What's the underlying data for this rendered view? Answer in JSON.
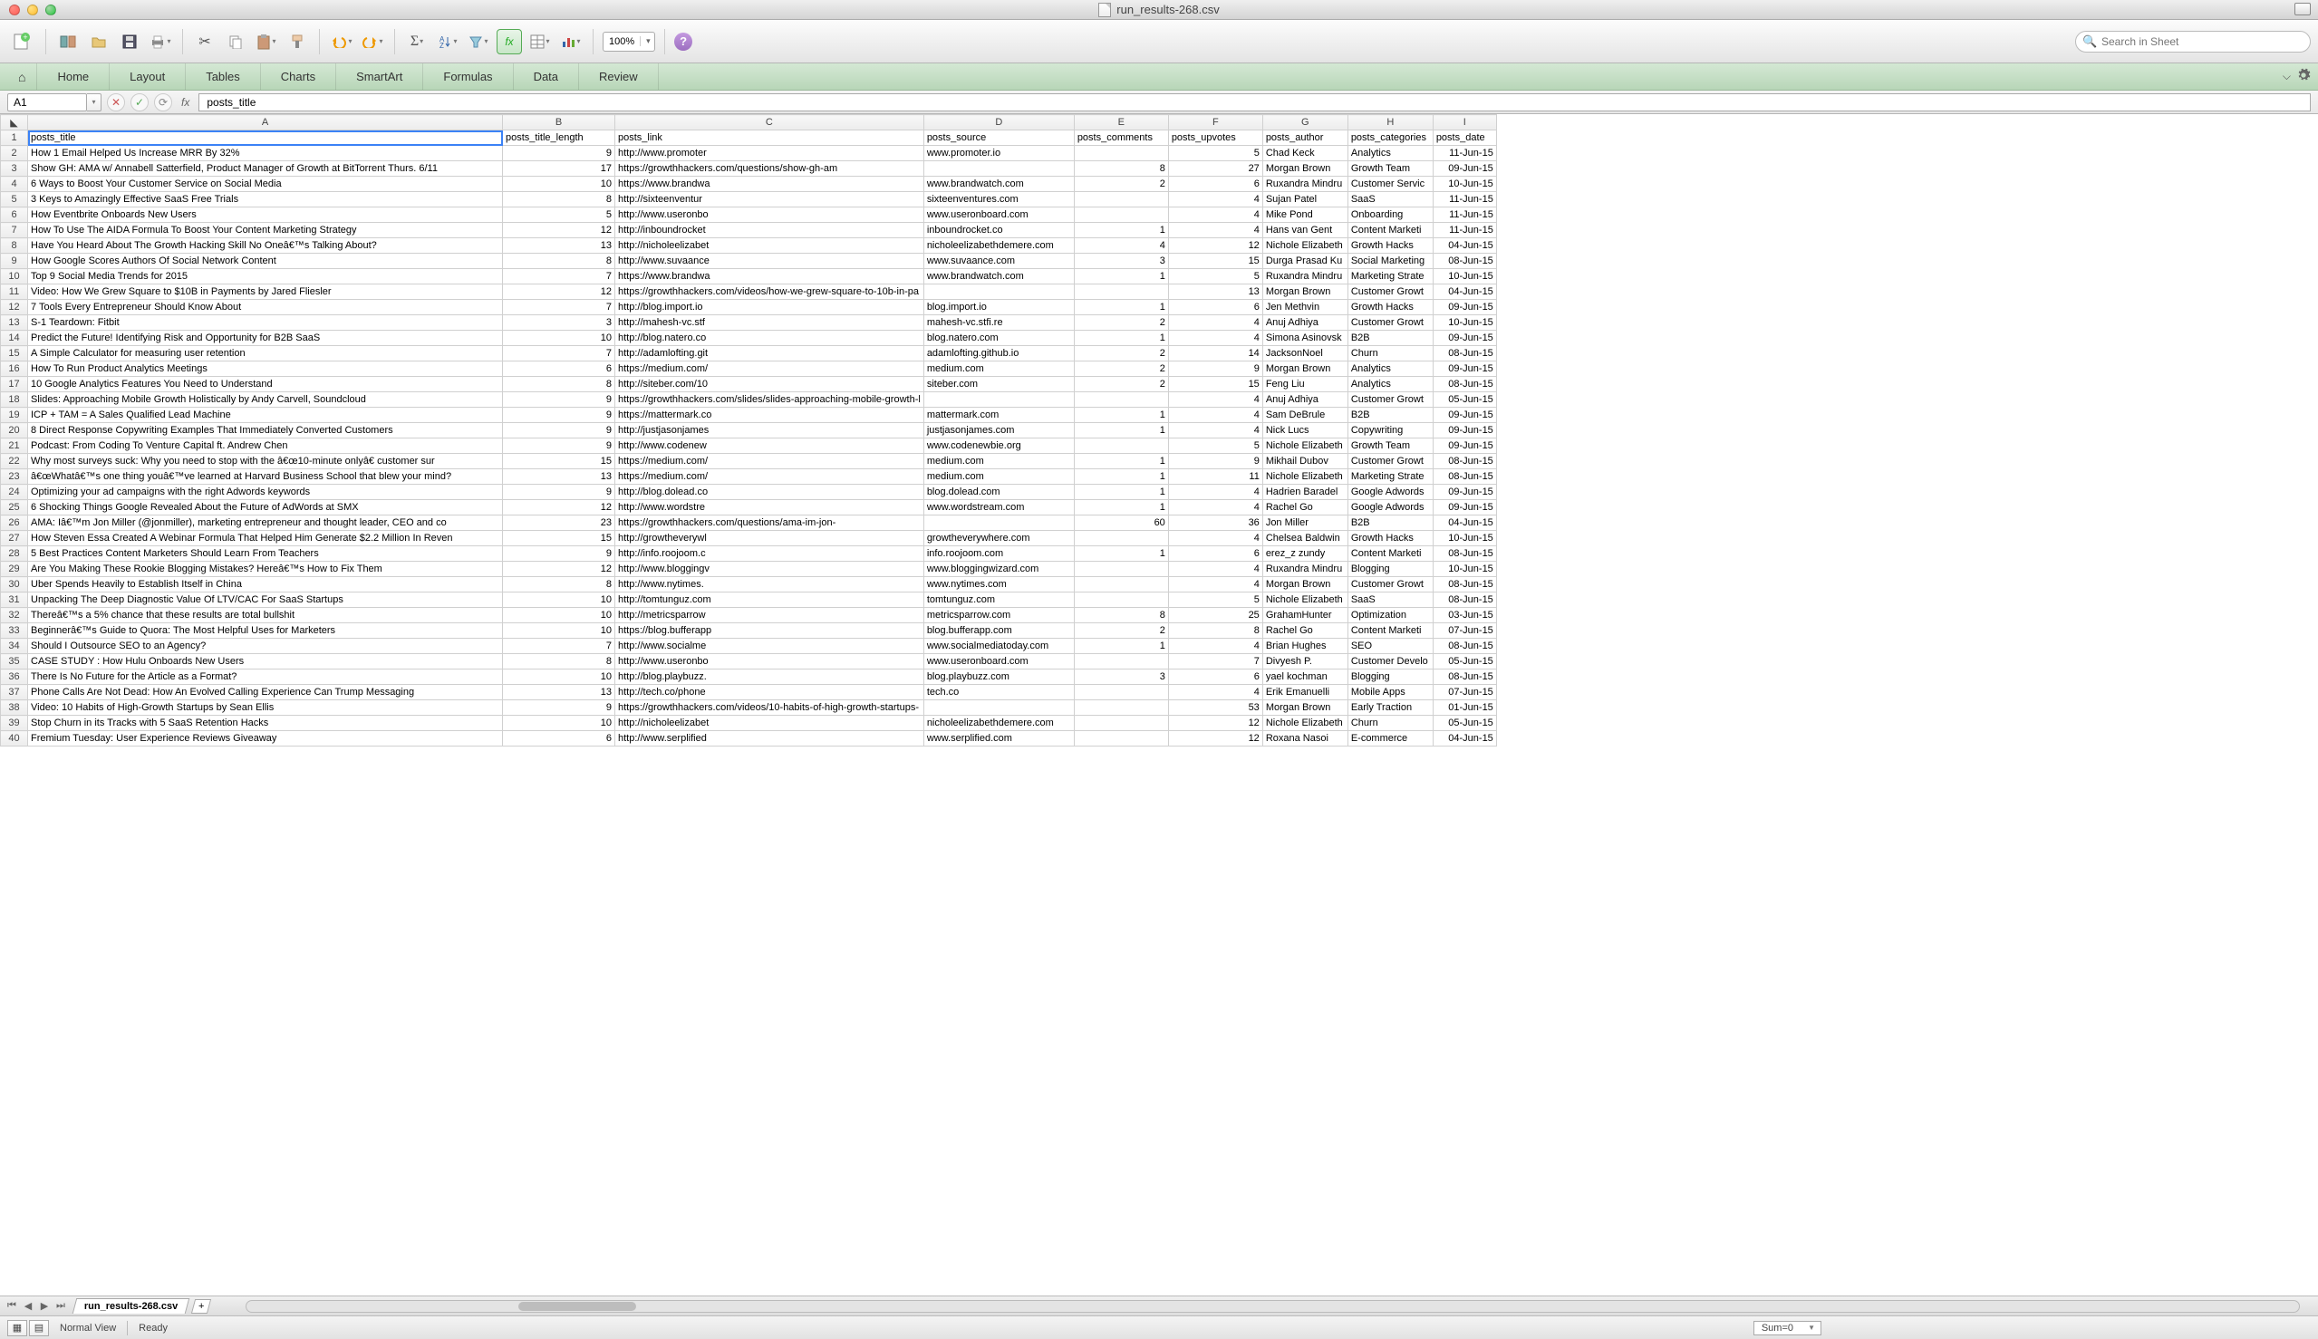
{
  "window": {
    "title": "run_results-268.csv"
  },
  "toolbar": {
    "zoom": "100%",
    "search_placeholder": "Search in Sheet"
  },
  "ribbon": {
    "tabs": [
      "Home",
      "Layout",
      "Tables",
      "Charts",
      "SmartArt",
      "Formulas",
      "Data",
      "Review"
    ]
  },
  "formula_bar": {
    "cell_ref": "A1",
    "fx": "fx",
    "value": "posts_title"
  },
  "sheet": {
    "columns": [
      "A",
      "B",
      "C",
      "D",
      "E",
      "F",
      "G",
      "H",
      "I"
    ],
    "headers": {
      "A": "posts_title",
      "B": "posts_title_length",
      "C": "posts_link",
      "D": "posts_source",
      "E": "posts_comments",
      "F": "posts_upvotes",
      "G": "posts_author",
      "H": "posts_categories",
      "I": "posts_date"
    },
    "rows": [
      {
        "A": "How 1 Email Helped Us Increase MRR By 32%",
        "B": 9,
        "C": "http://www.promoter",
        "D": "www.promoter.io",
        "E": "",
        "F": 5,
        "G": "Chad Keck",
        "H": "Analytics",
        "I": "11-Jun-15"
      },
      {
        "A": "Show GH: AMA w/ Annabell Satterfield, Product Manager of Growth at BitTorrent Thurs. 6/11",
        "B": 17,
        "C": "https://growthhackers.com/questions/show-gh-am",
        "D": "",
        "E": 8,
        "F": 27,
        "G": "Morgan Brown",
        "H": "Growth Team",
        "I": "09-Jun-15"
      },
      {
        "A": "6 Ways to Boost Your Customer Service on Social Media",
        "B": 10,
        "C": "https://www.brandwa",
        "D": "www.brandwatch.com",
        "E": 2,
        "F": 6,
        "G": "Ruxandra Mindru",
        "H": "Customer Servic",
        "I": "10-Jun-15"
      },
      {
        "A": "3 Keys to Amazingly Effective SaaS Free Trials",
        "B": 8,
        "C": "http://sixteenventur",
        "D": "sixteenventures.com",
        "E": "",
        "F": 4,
        "G": "Sujan Patel",
        "H": "SaaS",
        "I": "11-Jun-15"
      },
      {
        "A": "How Eventbrite Onboards New Users",
        "B": 5,
        "C": "http://www.useronbo",
        "D": "www.useronboard.com",
        "E": "",
        "F": 4,
        "G": "Mike Pond",
        "H": "Onboarding",
        "I": "11-Jun-15"
      },
      {
        "A": "How To Use The AIDA Formula To Boost Your Content Marketing Strategy",
        "B": 12,
        "C": "http://inboundrocket",
        "D": "inboundrocket.co",
        "E": 1,
        "F": 4,
        "G": "Hans van Gent",
        "H": "Content Marketi",
        "I": "11-Jun-15"
      },
      {
        "A": "Have You Heard About The Growth Hacking Skill No Oneâ€™s Talking About?",
        "B": 13,
        "C": "http://nicholeelizabet",
        "D": "nicholeelizabethdemere.com",
        "E": 4,
        "F": 12,
        "G": "Nichole Elizabeth",
        "H": "Growth Hacks",
        "I": "04-Jun-15"
      },
      {
        "A": "How Google Scores Authors Of Social Network Content",
        "B": 8,
        "C": "http://www.suvaance",
        "D": "www.suvaance.com",
        "E": 3,
        "F": 15,
        "G": "Durga Prasad Ku",
        "H": "Social Marketing",
        "I": "08-Jun-15"
      },
      {
        "A": "Top 9 Social Media Trends for 2015",
        "B": 7,
        "C": "https://www.brandwa",
        "D": "www.brandwatch.com",
        "E": 1,
        "F": 5,
        "G": "Ruxandra Mindru",
        "H": "Marketing Strate",
        "I": "10-Jun-15"
      },
      {
        "A": "Video: How We Grew Square to $10B in Payments by Jared Fliesler",
        "B": 12,
        "C": "https://growthhackers.com/videos/how-we-grew-square-to-10b-in-pa",
        "D": "",
        "E": "",
        "F": 13,
        "G": "Morgan Brown",
        "H": "Customer Growt",
        "I": "04-Jun-15"
      },
      {
        "A": "7 Tools Every Entrepreneur Should Know About",
        "B": 7,
        "C": "http://blog.import.io",
        "D": "blog.import.io",
        "E": 1,
        "F": 6,
        "G": "Jen Methvin",
        "H": "Growth Hacks",
        "I": "09-Jun-15"
      },
      {
        "A": "S-1 Teardown: Fitbit",
        "B": 3,
        "C": "http://mahesh-vc.stf",
        "D": "mahesh-vc.stfi.re",
        "E": 2,
        "F": 4,
        "G": "Anuj Adhiya",
        "H": "Customer Growt",
        "I": "10-Jun-15"
      },
      {
        "A": "Predict the Future! Identifying Risk and Opportunity for B2B SaaS",
        "B": 10,
        "C": "http://blog.natero.co",
        "D": "blog.natero.com",
        "E": 1,
        "F": 4,
        "G": "Simona Asinovsk",
        "H": "B2B",
        "I": "09-Jun-15"
      },
      {
        "A": "A Simple Calculator for measuring user retention",
        "B": 7,
        "C": "http://adamlofting.git",
        "D": "adamlofting.github.io",
        "E": 2,
        "F": 14,
        "G": "JacksonNoel",
        "H": "Churn",
        "I": "08-Jun-15"
      },
      {
        "A": "How To Run Product Analytics Meetings",
        "B": 6,
        "C": "https://medium.com/",
        "D": "medium.com",
        "E": 2,
        "F": 9,
        "G": "Morgan Brown",
        "H": "Analytics",
        "I": "09-Jun-15"
      },
      {
        "A": "10 Google Analytics Features You Need to Understand",
        "B": 8,
        "C": "http://siteber.com/10",
        "D": "siteber.com",
        "E": 2,
        "F": 15,
        "G": "Feng Liu",
        "H": "Analytics",
        "I": "08-Jun-15"
      },
      {
        "A": "Slides: Approaching Mobile Growth Holistically by Andy Carvell, Soundcloud",
        "B": 9,
        "C": "https://growthhackers.com/slides/slides-approaching-mobile-growth-l",
        "D": "",
        "E": "",
        "F": 4,
        "G": "Anuj Adhiya",
        "H": "Customer Growt",
        "I": "05-Jun-15"
      },
      {
        "A": "ICP + TAM = A Sales Qualified Lead Machine",
        "B": 9,
        "C": "https://mattermark.co",
        "D": "mattermark.com",
        "E": 1,
        "F": 4,
        "G": "Sam DeBrule",
        "H": "B2B",
        "I": "09-Jun-15"
      },
      {
        "A": "8 Direct Response Copywriting Examples That Immediately Converted Customers",
        "B": 9,
        "C": "http://justjasonjames",
        "D": "justjasonjames.com",
        "E": 1,
        "F": 4,
        "G": "Nick Lucs",
        "H": "Copywriting",
        "I": "09-Jun-15"
      },
      {
        "A": "Podcast: From Coding To Venture Capital ft. Andrew Chen",
        "B": 9,
        "C": "http://www.codenew",
        "D": "www.codenewbie.org",
        "E": "",
        "F": 5,
        "G": "Nichole Elizabeth",
        "H": "Growth Team",
        "I": "09-Jun-15"
      },
      {
        "A": "Why most surveys suck: Why you need to stop with the â€œ10-minute onlyâ€   customer sur",
        "B": 15,
        "C": "https://medium.com/",
        "D": "medium.com",
        "E": 1,
        "F": 9,
        "G": "Mikhail Dubov",
        "H": "Customer Growt",
        "I": "08-Jun-15"
      },
      {
        "A": "â€œWhatâ€™s one thing youâ€™ve learned at Harvard Business School that blew your mind?",
        "B": 13,
        "C": "https://medium.com/",
        "D": "medium.com",
        "E": 1,
        "F": 11,
        "G": "Nichole Elizabeth",
        "H": "Marketing Strate",
        "I": "08-Jun-15"
      },
      {
        "A": "Optimizing your ad campaigns with the right Adwords keywords",
        "B": 9,
        "C": "http://blog.dolead.co",
        "D": "blog.dolead.com",
        "E": 1,
        "F": 4,
        "G": "Hadrien Baradel",
        "H": "Google Adwords",
        "I": "09-Jun-15"
      },
      {
        "A": "6 Shocking Things Google Revealed About the Future of AdWords at SMX",
        "B": 12,
        "C": "http://www.wordstre",
        "D": "www.wordstream.com",
        "E": 1,
        "F": 4,
        "G": "Rachel Go",
        "H": "Google Adwords",
        "I": "09-Jun-15"
      },
      {
        "A": "AMA: Iâ€™m Jon Miller (@jonmiller), marketing entrepreneur and thought leader, CEO and co",
        "B": 23,
        "C": "https://growthhackers.com/questions/ama-im-jon-",
        "D": "",
        "E": 60,
        "F": 36,
        "G": "Jon Miller",
        "H": "B2B",
        "I": "04-Jun-15"
      },
      {
        "A": "How Steven Essa Created A Webinar Formula That Helped Him Generate $2.2 Million In Reven",
        "B": 15,
        "C": "http://growtheverywl",
        "D": "growtheverywhere.com",
        "E": "",
        "F": 4,
        "G": "Chelsea Baldwin",
        "H": "Growth Hacks",
        "I": "10-Jun-15"
      },
      {
        "A": "5 Best Practices Content Marketers Should Learn From Teachers",
        "B": 9,
        "C": "http://info.roojoom.c",
        "D": "info.roojoom.com",
        "E": 1,
        "F": 6,
        "G": "erez_z zundy",
        "H": "Content Marketi",
        "I": "08-Jun-15"
      },
      {
        "A": "Are You Making These Rookie Blogging Mistakes? Hereâ€™s How to Fix Them",
        "B": 12,
        "C": "http://www.bloggingv",
        "D": "www.bloggingwizard.com",
        "E": "",
        "F": 4,
        "G": "Ruxandra Mindru",
        "H": "Blogging",
        "I": "10-Jun-15"
      },
      {
        "A": "Uber Spends Heavily to Establish Itself in China",
        "B": 8,
        "C": "http://www.nytimes.",
        "D": "www.nytimes.com",
        "E": "",
        "F": 4,
        "G": "Morgan Brown",
        "H": "Customer Growt",
        "I": "08-Jun-15"
      },
      {
        "A": "Unpacking The Deep Diagnostic Value Of LTV/CAC For SaaS Startups",
        "B": 10,
        "C": "http://tomtunguz.com",
        "D": "tomtunguz.com",
        "E": "",
        "F": 5,
        "G": "Nichole Elizabeth",
        "H": "SaaS",
        "I": "08-Jun-15"
      },
      {
        "A": "Thereâ€™s a 5% chance that these results are total bullshit",
        "B": 10,
        "C": "http://metricsparrow",
        "D": "metricsparrow.com",
        "E": 8,
        "F": 25,
        "G": "GrahamHunter",
        "H": "Optimization",
        "I": "03-Jun-15"
      },
      {
        "A": "Beginnerâ€™s Guide to Quora: The Most Helpful Uses for Marketers",
        "B": 10,
        "C": "https://blog.bufferapp",
        "D": "blog.bufferapp.com",
        "E": 2,
        "F": 8,
        "G": "Rachel Go",
        "H": "Content Marketi",
        "I": "07-Jun-15"
      },
      {
        "A": "Should I Outsource SEO to an Agency?",
        "B": 7,
        "C": "http://www.socialme",
        "D": "www.socialmediatoday.com",
        "E": 1,
        "F": 4,
        "G": "Brian Hughes",
        "H": "SEO",
        "I": "08-Jun-15"
      },
      {
        "A": "CASE STUDY : How Hulu Onboards New Users",
        "B": 8,
        "C": "http://www.useronbo",
        "D": "www.useronboard.com",
        "E": "",
        "F": 7,
        "G": "Divyesh P.",
        "H": "Customer Develo",
        "I": "05-Jun-15"
      },
      {
        "A": "There Is No Future for the Article as a Format?",
        "B": 10,
        "C": "http://blog.playbuzz.",
        "D": "blog.playbuzz.com",
        "E": 3,
        "F": 6,
        "G": "yael kochman",
        "H": "Blogging",
        "I": "08-Jun-15"
      },
      {
        "A": "Phone Calls Are Not Dead: How An Evolved Calling Experience Can Trump Messaging",
        "B": 13,
        "C": "http://tech.co/phone",
        "D": "tech.co",
        "E": "",
        "F": 4,
        "G": "Erik Emanuelli",
        "H": "Mobile Apps",
        "I": "07-Jun-15"
      },
      {
        "A": "Video: 10 Habits of High-Growth Startups by Sean Ellis",
        "B": 9,
        "C": "https://growthhackers.com/videos/10-habits-of-high-growth-startups-",
        "D": "",
        "E": "",
        "F": 53,
        "G": "Morgan Brown",
        "H": "Early Traction",
        "I": "01-Jun-15"
      },
      {
        "A": "Stop Churn in its Tracks with 5 SaaS Retention Hacks",
        "B": 10,
        "C": "http://nicholeelizabet",
        "D": "nicholeelizabethdemere.com",
        "E": "",
        "F": 12,
        "G": "Nichole Elizabeth",
        "H": "Churn",
        "I": "05-Jun-15"
      },
      {
        "A": "Fremium Tuesday: User Experience Reviews Giveaway",
        "B": 6,
        "C": "http://www.serplified",
        "D": "www.serplified.com",
        "E": "",
        "F": 12,
        "G": "Roxana Nasoi",
        "H": "E-commerce",
        "I": "04-Jun-15"
      }
    ]
  },
  "sheet_tabs": {
    "active": "run_results-268.csv"
  },
  "status": {
    "view_label": "Normal View",
    "ready": "Ready",
    "sum": "Sum=0"
  }
}
